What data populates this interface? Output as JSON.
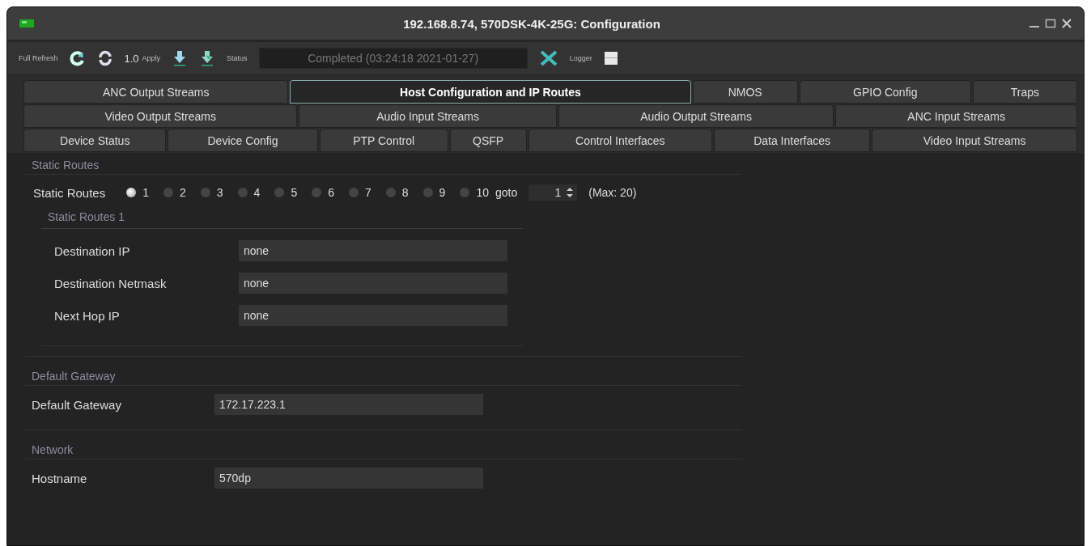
{
  "window": {
    "title": "192.168.8.74, 570DSK-4K-25G: Configuration"
  },
  "toolbar": {
    "full_refresh_label": "Full Refresh",
    "apply_value": "1.0",
    "apply_label": "Apply",
    "status_label": "Status",
    "status_value": "Completed  (03:24:18 2021-01-27)",
    "logger_label": "Logger"
  },
  "tab_rows": [
    [
      {
        "label": "ANC Output Streams",
        "selected": false
      },
      {
        "label": "Host Configuration and IP Routes",
        "selected": true
      },
      {
        "label": "NMOS",
        "selected": false
      },
      {
        "label": "GPIO Config",
        "selected": false
      },
      {
        "label": "Traps",
        "selected": false
      }
    ],
    [
      {
        "label": "Video Output Streams",
        "selected": false
      },
      {
        "label": "Audio Input Streams",
        "selected": false
      },
      {
        "label": "Audio Output Streams",
        "selected": false
      },
      {
        "label": "ANC Input Streams",
        "selected": false
      }
    ],
    [
      {
        "label": "Device Status",
        "selected": false
      },
      {
        "label": "Device Config",
        "selected": false
      },
      {
        "label": "PTP Control",
        "selected": false
      },
      {
        "label": "QSFP",
        "selected": false
      },
      {
        "label": "Control Interfaces",
        "selected": false
      },
      {
        "label": "Data Interfaces",
        "selected": false
      },
      {
        "label": "Video Input Streams",
        "selected": false
      }
    ]
  ],
  "static_routes": {
    "title": "Static Routes",
    "label": "Static Routes",
    "radios": [
      {
        "label": "1",
        "selected": true
      },
      {
        "label": "2",
        "selected": false
      },
      {
        "label": "3",
        "selected": false
      },
      {
        "label": "4",
        "selected": false
      },
      {
        "label": "5",
        "selected": false
      },
      {
        "label": "6",
        "selected": false
      },
      {
        "label": "7",
        "selected": false
      },
      {
        "label": "8",
        "selected": false
      },
      {
        "label": "9",
        "selected": false
      },
      {
        "label": "10",
        "selected": false
      }
    ],
    "goto_label": "goto",
    "goto_value": "1",
    "max_label": "(Max: 20)",
    "group_title": "Static Routes 1",
    "fields": [
      {
        "label": "Destination IP",
        "value": "none"
      },
      {
        "label": "Destination Netmask",
        "value": "none"
      },
      {
        "label": "Next Hop IP",
        "value": "none"
      }
    ]
  },
  "sections": [
    {
      "title": "Default Gateway",
      "fields": [
        {
          "label": "Default Gateway",
          "value": "172.17.223.1"
        }
      ]
    },
    {
      "title": "Network",
      "fields": [
        {
          "label": "Hostname",
          "value": "570dp"
        }
      ]
    }
  ]
}
